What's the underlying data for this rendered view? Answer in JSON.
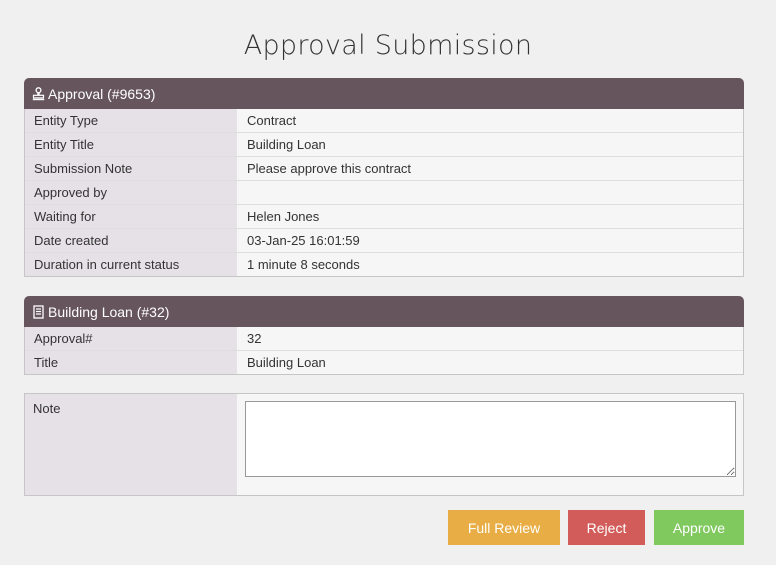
{
  "page": {
    "title": "Approval Submission"
  },
  "approval_panel": {
    "header": "Approval (#9653)",
    "icon": "stamp-icon",
    "rows": [
      {
        "label": "Entity Type",
        "value": "Contract"
      },
      {
        "label": "Entity Title",
        "value": "Building Loan"
      },
      {
        "label": "Submission Note",
        "value": "Please approve this contract"
      },
      {
        "label": "Approved by",
        "value": ""
      },
      {
        "label": "Waiting for",
        "value": "Helen Jones"
      },
      {
        "label": "Date created",
        "value": "03-Jan-25 16:01:59"
      },
      {
        "label": "Duration in current status",
        "value": "1 minute 8 seconds"
      }
    ]
  },
  "entity_panel": {
    "header": "Building Loan (#32)",
    "icon": "document-icon",
    "rows": [
      {
        "label": "Approval#",
        "value": "32"
      },
      {
        "label": "Title",
        "value": "Building Loan"
      }
    ]
  },
  "note": {
    "label": "Note",
    "value": ""
  },
  "buttons": {
    "full_review": "Full Review",
    "reject": "Reject",
    "approve": "Approve"
  },
  "colors": {
    "header_bg": "#66555c",
    "label_bg": "#e6e1e7",
    "full_review": "#e8ad44",
    "reject": "#d15c59",
    "approve": "#80c95f"
  }
}
